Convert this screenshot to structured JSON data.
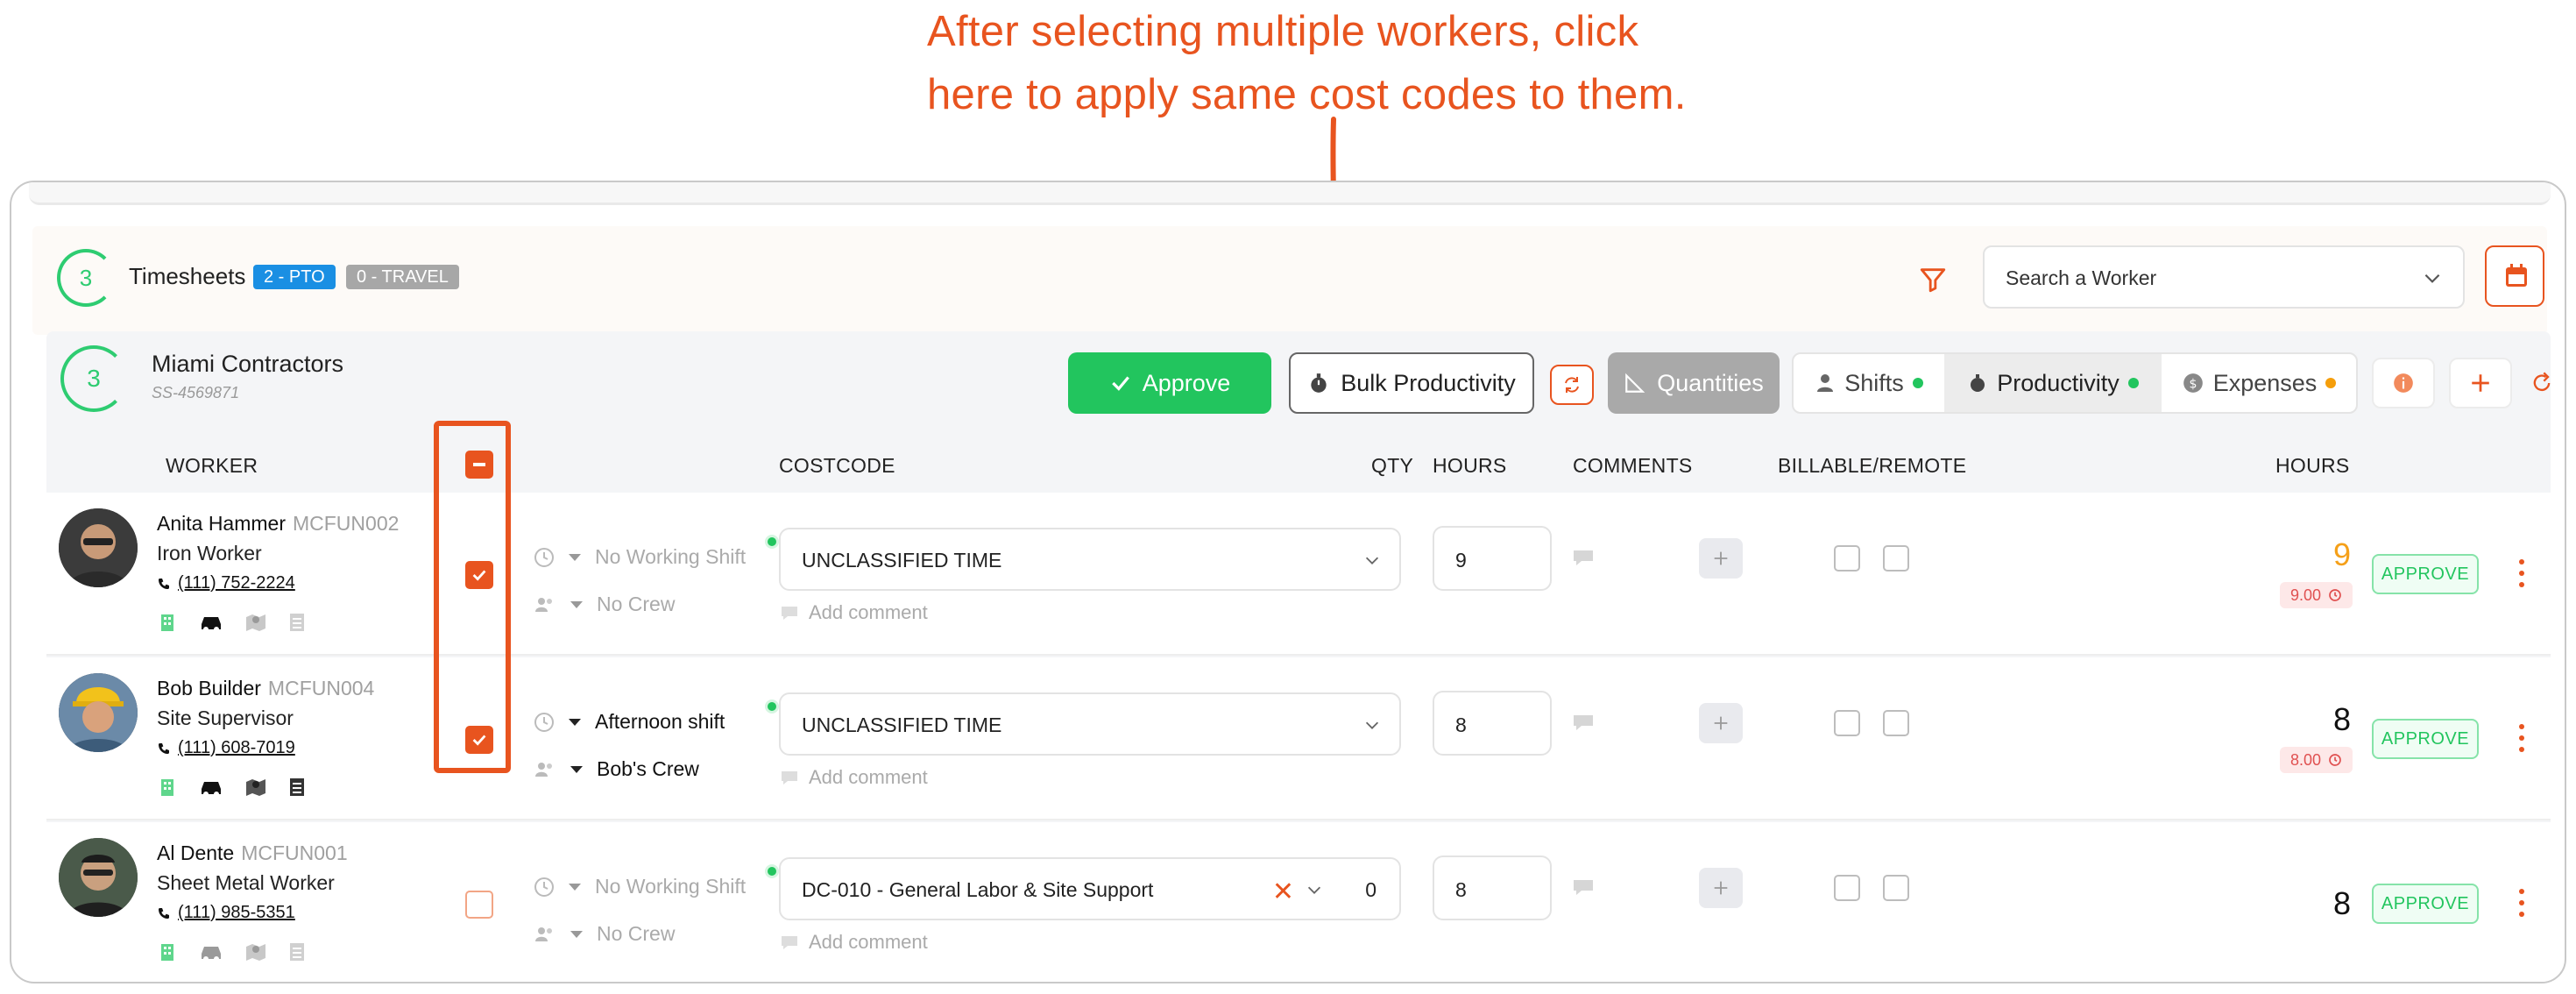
{
  "annotation": {
    "line1": "After selecting multiple workers, click",
    "line2": "here to apply same cost codes to them."
  },
  "timesheets": {
    "count": "3",
    "title": "Timesheets",
    "badge_pto": "2 - PTO",
    "badge_travel": "0 - TRAVEL",
    "search_placeholder": "Search a Worker"
  },
  "company": {
    "count": "3",
    "name": "Miami Contractors",
    "id": "SS-4569871"
  },
  "toolbar": {
    "approve": "Approve",
    "bulk_productivity": "Bulk Productivity",
    "quantities": "Quantities",
    "shifts": "Shifts",
    "productivity": "Productivity",
    "expenses": "Expenses"
  },
  "columns": {
    "worker": "WORKER",
    "costcode": "COSTCODE",
    "qty": "QTY",
    "hours": "HOURS",
    "comments": "COMMENTS",
    "billable": "BILLABLE/REMOTE",
    "total_hours": "HOURS"
  },
  "workers": [
    {
      "name": "Anita Hammer",
      "code": "MCFUN002",
      "trade": "Iron Worker",
      "phone": "(111) 752-2224",
      "checked": true,
      "shift": "No Working Shift",
      "crew": "No Crew",
      "costcode": "UNCLASSIFIED TIME",
      "hours": "9",
      "add_comment": "Add comment",
      "total": "9",
      "pill": "9.00",
      "approve": "APPROVE"
    },
    {
      "name": "Bob Builder",
      "code": "MCFUN004",
      "trade": "Site Supervisor",
      "phone": "(111) 608-7019",
      "checked": true,
      "shift": "Afternoon shift",
      "crew": "Bob's Crew",
      "costcode": "UNCLASSIFIED TIME",
      "hours": "8",
      "add_comment": "Add comment",
      "total": "8",
      "pill": "8.00",
      "approve": "APPROVE"
    },
    {
      "name": "Al Dente",
      "code": "MCFUN001",
      "trade": "Sheet Metal Worker",
      "phone": "(111) 985-5351",
      "checked": false,
      "shift": "No Working Shift",
      "crew": "No Crew",
      "costcode": "DC-010 - General Labor & Site Support",
      "qty": "0",
      "hours": "8",
      "add_comment": "Add comment",
      "total": "8",
      "approve": "APPROVE"
    }
  ],
  "colors": {
    "accent": "#e8541f",
    "green": "#22c55e",
    "orange_total": "#f5a019"
  }
}
